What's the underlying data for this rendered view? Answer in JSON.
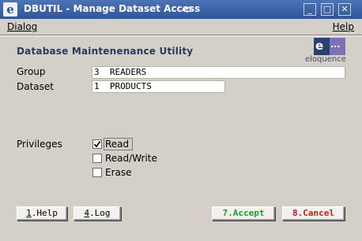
{
  "window": {
    "title": "DBUTIL - Manage Dataset Access",
    "minimize_label": "_",
    "maximize_label": "□",
    "close_label": "✕"
  },
  "menubar": {
    "dialog": "Dialog",
    "help": "Help"
  },
  "header": {
    "title": "Database Maintenenance Utility",
    "logo_text": "eloquence",
    "logo_letter": "e",
    "logo_dots": "..."
  },
  "form": {
    "group_label": "Group",
    "group_value": "3  READERS",
    "dataset_label": "Dataset",
    "dataset_value": "1  PRODUCTS",
    "privileges_label": "Privileges",
    "privileges": [
      {
        "label": "Read",
        "checked": true
      },
      {
        "label": "Read/Write",
        "checked": false
      },
      {
        "label": "Erase",
        "checked": false
      }
    ]
  },
  "buttons": {
    "help_key": "1",
    "help_text": ".Help",
    "log_key": "4",
    "log_text": ".Log",
    "accept": "7.Accept",
    "cancel": "8.Cancel"
  },
  "colors": {
    "titlebar": "#3a61a6",
    "accept": "#1f9a2e",
    "cancel": "#c81b1b",
    "background": "#d4d0c8"
  }
}
